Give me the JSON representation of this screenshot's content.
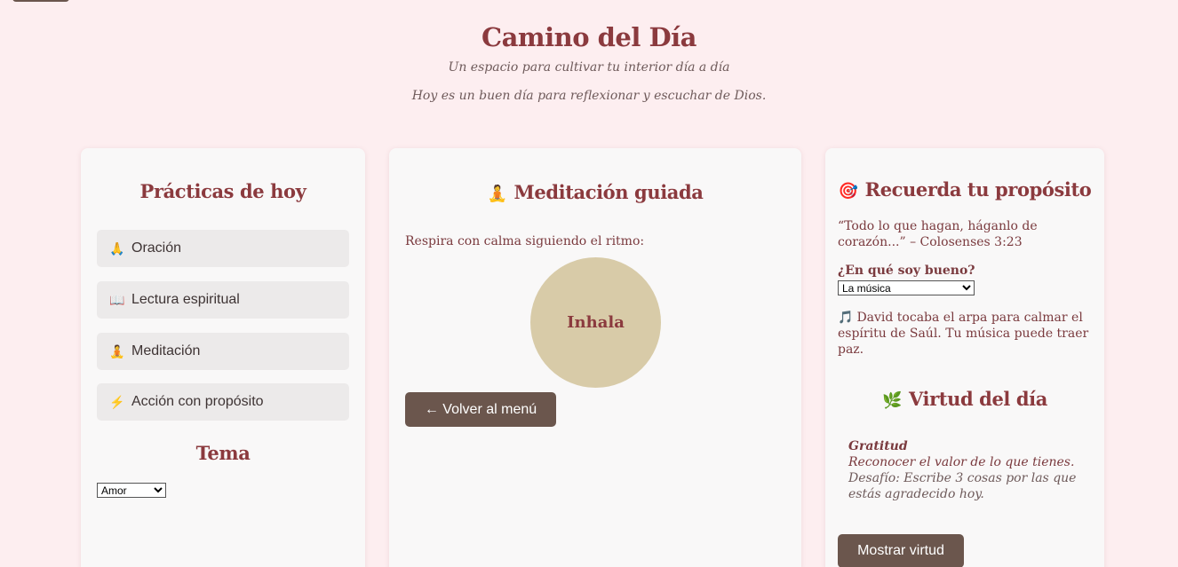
{
  "header": {
    "title": "Camino del Día",
    "subtitle": "Un espacio para cultivar tu interior día a día",
    "message": "Hoy es un buen día para reflexionar y escuchar de Dios."
  },
  "practices": {
    "heading": "Prácticas de hoy",
    "items": [
      {
        "icon": "🙏",
        "icon_name": "praying-hands-icon",
        "label": "Oración"
      },
      {
        "icon": "📖",
        "icon_name": "open-book-icon",
        "label": "Lectura espiritual"
      },
      {
        "icon": "🧘",
        "icon_name": "meditation-icon",
        "label": "Meditación"
      },
      {
        "icon": "⚡",
        "icon_name": "lightning-icon",
        "label": "Acción con propósito"
      }
    ],
    "theme_heading": "Tema",
    "theme_selected": "Amor"
  },
  "meditation": {
    "icon": "🧘",
    "heading": "Meditación guiada",
    "instruction": "Respira con calma siguiendo el ritmo:",
    "breath_state": "Inhala",
    "back_button": "← Volver al menú",
    "circle_color": "#d8cba8"
  },
  "purpose": {
    "icon": "🎯",
    "heading": "Recuerda tu propósito",
    "quote": "“Todo lo que hagan, háganlo de corazón...” – Colosenses 3:23",
    "question": "¿En qué soy bueno?",
    "selected": "La música",
    "note_icon": "🎵",
    "note": "David tocaba el arpa para calmar el espíritu de Saúl. Tu música puede traer paz."
  },
  "virtue": {
    "icon": "🌿",
    "heading": "Virtud del día",
    "name": "Gratitud",
    "description": "Reconocer el valor de lo que tienes.",
    "challenge": "Desafío: Escribe 3 cosas por las que estás agradecido hoy.",
    "button": "Mostrar virtud"
  },
  "colors": {
    "background": "#fdeef0",
    "accent": "#8b3a3e",
    "button": "#6b564d"
  }
}
